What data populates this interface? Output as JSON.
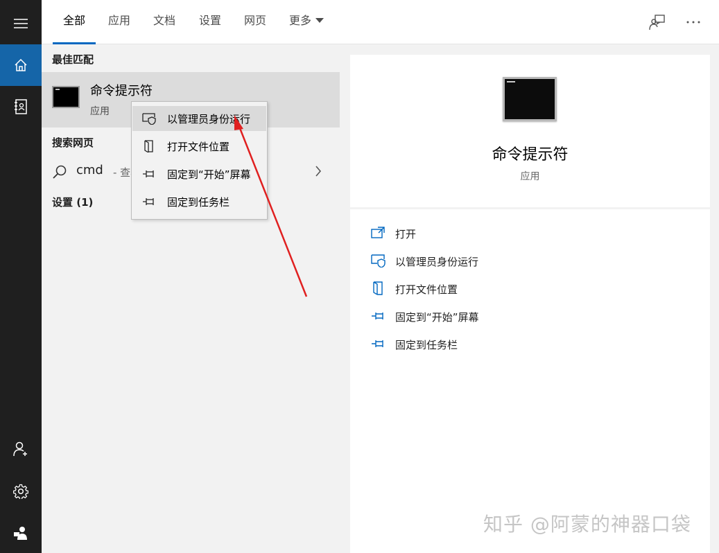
{
  "tabs": [
    {
      "label": "全部",
      "active": true
    },
    {
      "label": "应用"
    },
    {
      "label": "文档"
    },
    {
      "label": "设置"
    },
    {
      "label": "网页"
    },
    {
      "label": "更多"
    }
  ],
  "sections": {
    "best_match": "最佳匹配",
    "search_web": "搜索网页",
    "settings": "设置 (1)"
  },
  "best_match": {
    "title": "命令提示符",
    "subtitle": "应用",
    "icon": "terminal-icon"
  },
  "web_search": {
    "query": "cmd",
    "hint": "- 查看"
  },
  "context_menu": [
    {
      "label": "以管理员身份运行",
      "icon": "shield-icon",
      "highlighted": true
    },
    {
      "label": "打开文件位置",
      "icon": "folder-open-icon"
    },
    {
      "label": "固定到“开始”屏幕",
      "icon": "pin-icon"
    },
    {
      "label": "固定到任务栏",
      "icon": "pin-icon"
    }
  ],
  "preview": {
    "title": "命令提示符",
    "subtitle": "应用",
    "actions": [
      {
        "label": "打开",
        "icon": "open-icon"
      },
      {
        "label": "以管理员身份运行",
        "icon": "shield-icon"
      },
      {
        "label": "打开文件位置",
        "icon": "folder-open-icon"
      },
      {
        "label": "固定到“开始”屏幕",
        "icon": "pin-icon"
      },
      {
        "label": "固定到任务栏",
        "icon": "pin-icon"
      }
    ]
  },
  "watermark": "知乎 @阿蒙的神器口袋",
  "colors": {
    "accent": "#0067c0",
    "rail": "#1f1f1f",
    "rail_active": "#1565a8",
    "arrow": "#e02020"
  }
}
